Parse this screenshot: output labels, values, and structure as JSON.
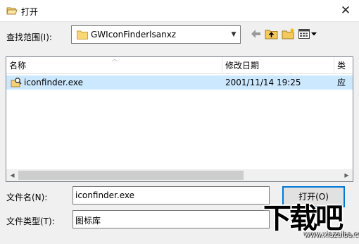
{
  "window": {
    "title": "打开",
    "close_symbol": "✕"
  },
  "look_in": {
    "label": "查找范围(I):",
    "value": "GWIconFinderlsanxz"
  },
  "toolbar": [
    "back-icon",
    "up-folder-icon",
    "new-folder-icon",
    "view-menu-icon"
  ],
  "columns": {
    "name": "名称",
    "date": "修改日期",
    "type": "类"
  },
  "files": [
    {
      "name": "iconfinder.exe",
      "date": "2001/11/14 19:25",
      "type": "应"
    }
  ],
  "filename": {
    "label": "文件名(N):",
    "value": "iconfinder.exe"
  },
  "filetype": {
    "label": "文件类型(T):",
    "value": "图标库"
  },
  "buttons": {
    "open": "打开(O)"
  },
  "watermark": {
    "logo": "下载吧",
    "url": "www.xiazaiba.com"
  }
}
